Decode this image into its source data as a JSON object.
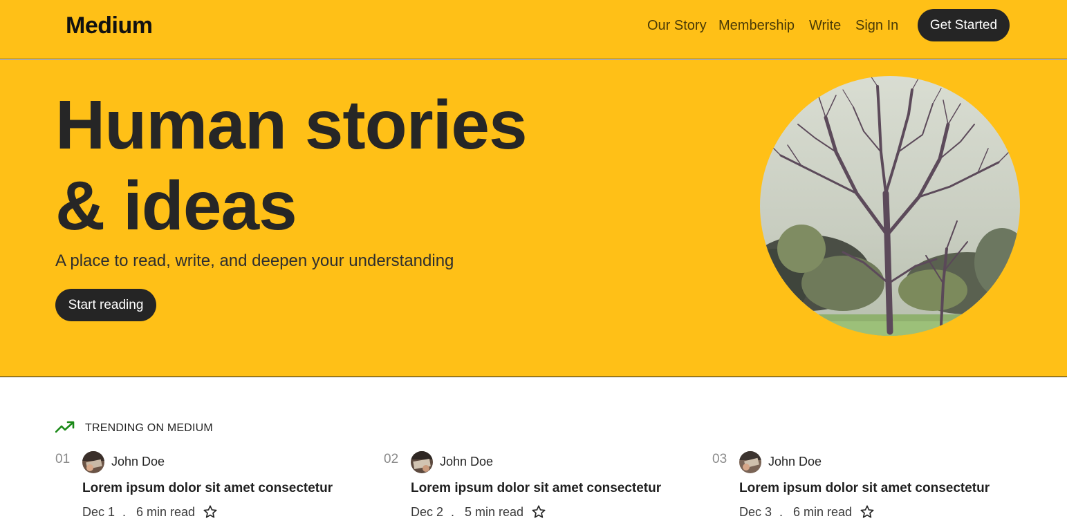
{
  "header": {
    "logo": "Medium",
    "nav": [
      "Our Story",
      "Membership",
      "Write",
      "Sign In"
    ],
    "cta": "Get Started"
  },
  "hero": {
    "title_line1": "Human stories",
    "title_line2": "& ideas",
    "subtitle": "A place to read, write, and deepen your understanding",
    "button": "Start reading",
    "image_icon": "tree-photo"
  },
  "trending": {
    "label": "TRENDING ON MEDIUM",
    "icon": "trending-up-icon",
    "items": [
      {
        "number": "01",
        "author": "John Doe",
        "title": "Lorem ipsum dolor sit amet consectetur",
        "date": "Dec 1",
        "separator": ".",
        "read_time": "6 min read"
      },
      {
        "number": "02",
        "author": "John Doe",
        "title": "Lorem ipsum dolor sit amet consectetur",
        "date": "Dec 2",
        "separator": ".",
        "read_time": "5 min read"
      },
      {
        "number": "03",
        "author": "John Doe",
        "title": "Lorem ipsum dolor sit amet consectetur",
        "date": "Dec 3",
        "separator": ".",
        "read_time": "6 min read"
      }
    ]
  },
  "colors": {
    "brand_yellow": "#FFC017",
    "button_dark": "#252525",
    "trend_green": "#1A8917"
  }
}
